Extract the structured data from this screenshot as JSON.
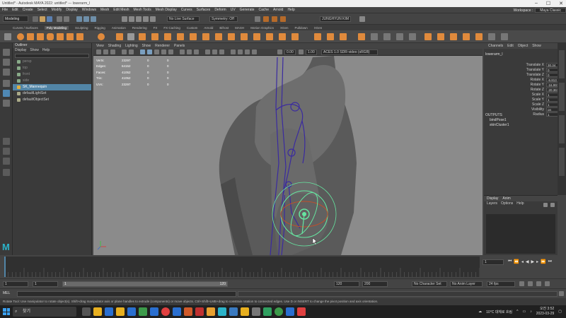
{
  "titlebar": {
    "title": "Untitled* - Autodesk MAYA 2022: untitled* --- lowerarm_l"
  },
  "menu": [
    "File",
    "Edit",
    "Create",
    "Select",
    "Modify",
    "Display",
    "Windows",
    "Mesh",
    "Edit Mesh",
    "Mesh Tools",
    "Mesh Display",
    "Curves",
    "Surfaces",
    "Deform",
    "UV",
    "Generate",
    "Cache",
    "Arnold",
    "Help"
  ],
  "workspace": {
    "label": "Workspace :",
    "value": "Maya Classic"
  },
  "status": {
    "mode": "Modeling",
    "live_surface": "No Live Surface",
    "symmetry": "Symmetry: Off",
    "user": "JUNGHYUN KIM"
  },
  "shelf_tabs": [
    "Curves / Surfaces",
    "Poly Modeling",
    "Sculpting",
    "Rigging",
    "Animation",
    "Rendering",
    "FX",
    "FX Caching",
    "Custom",
    "Arnold",
    "Bifrost",
    "MASH",
    "Motion Graphics",
    "XGen",
    "Pulldown",
    "XGen"
  ],
  "shelf_active": "Poly Modeling",
  "outliner": {
    "title": "Outliner",
    "menu": [
      "Display",
      "Show",
      "Help"
    ],
    "items": [
      {
        "label": "persp",
        "state": "dim"
      },
      {
        "label": "top",
        "state": "dim"
      },
      {
        "label": "front",
        "state": "dim"
      },
      {
        "label": "side",
        "state": "dim"
      },
      {
        "label": "SK_Mannequin",
        "state": "sel"
      },
      {
        "label": "defaultLightSet",
        "state": "normal"
      },
      {
        "label": "defaultObjectSet",
        "state": "normal"
      }
    ]
  },
  "viewport": {
    "menu": [
      "View",
      "Shading",
      "Lighting",
      "Show",
      "Renderer",
      "Panels"
    ],
    "field1": "0.00",
    "field2": "1.00",
    "colorspace": "ACES 1.0 SDR-video (sRGB)",
    "hud": [
      {
        "label": "Verts:",
        "a": "23297",
        "b": "0",
        "c": "0"
      },
      {
        "label": "Edges:",
        "a": "64152",
        "b": "0",
        "c": "0"
      },
      {
        "label": "Faces:",
        "a": "41052",
        "b": "0",
        "c": "0"
      },
      {
        "label": "Tris:",
        "a": "41052",
        "b": "0",
        "c": "0"
      },
      {
        "label": "UVs:",
        "a": "23297",
        "b": "0",
        "c": "0"
      }
    ]
  },
  "channel_box": {
    "tabs": [
      "Channels",
      "Edit",
      "Object",
      "Show"
    ],
    "node": "lowerarm_l",
    "attrs": [
      {
        "name": "Translate X",
        "value": "30.34"
      },
      {
        "name": "Translate Y",
        "value": "0"
      },
      {
        "name": "Translate Z",
        "value": "0"
      },
      {
        "name": "Rotate X",
        "value": "-6.813"
      },
      {
        "name": "Rotate Y",
        "value": "-16.997"
      },
      {
        "name": "Rotate Z",
        "value": "-20.361"
      },
      {
        "name": "Scale X",
        "value": "1"
      },
      {
        "name": "Scale Y",
        "value": "1"
      },
      {
        "name": "Scale Z",
        "value": "1"
      },
      {
        "name": "Visibility",
        "value": "on"
      },
      {
        "name": "Radius",
        "value": "1"
      }
    ],
    "outputs_label": "OUTPUTS",
    "outputs": [
      "bindPose1",
      "skinCluster1"
    ]
  },
  "layers": {
    "tabs": [
      "Display",
      "Anim"
    ],
    "menu": [
      "Layers",
      "Options",
      "Help"
    ]
  },
  "timeline": {
    "current": "1"
  },
  "range": {
    "start": "1",
    "inner_start": "1",
    "inner_end": "120",
    "end_a": "120",
    "end_b": "200",
    "char_set": "No Character Set",
    "anim_layer": "No Anim Layer",
    "fps": "24 fps"
  },
  "cmd": {
    "label": "MEL"
  },
  "help_text": "Rotate Tool: Use manipulator to rotate object(s). Shift+drag manipulator axis or plane handles to extrude (components) or move objects. Ctrl+Shift+LMB+drag to constrain rotation to connected edges. Use D or INSERT to change the pivot position and axis orientation.",
  "taskbar": {
    "search": "찾기",
    "weather": "10°C 대체로 흐림",
    "time": "오전 3:52",
    "date": "2023-03-29"
  },
  "colors": {
    "accent": "#5285a6",
    "selection": "#5285a6",
    "manip_green": "#66e5a0",
    "joint": "#3a2aa0"
  }
}
